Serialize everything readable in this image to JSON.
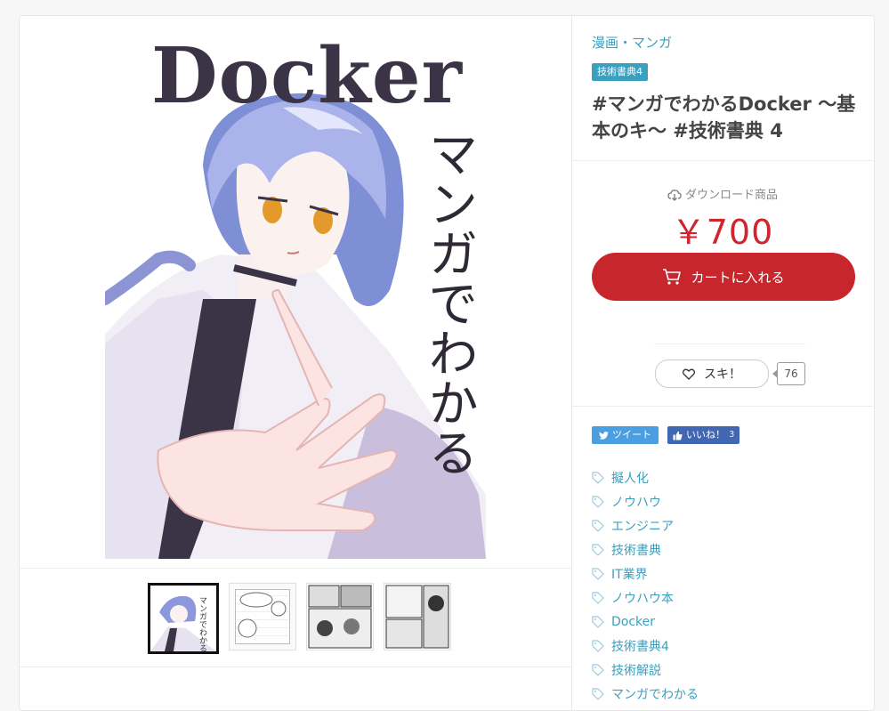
{
  "gallery": {
    "cover": {
      "title": "Docker",
      "subtitle": "マンガでわかる"
    },
    "thumbnails": [
      {
        "name": "thumb-1",
        "active": true
      },
      {
        "name": "thumb-2",
        "active": false
      },
      {
        "name": "thumb-3",
        "active": false
      },
      {
        "name": "thumb-4",
        "active": false
      }
    ]
  },
  "product": {
    "category": "漫画・マンガ",
    "event_badge": "技術書典4",
    "title": "#マンガでわかるDocker 〜基本のキ〜 #技術書典 4",
    "download_label": "ダウンロード商品",
    "price": "￥700",
    "cart_button": "カートに入れる",
    "like_label": "スキ！",
    "like_count": "76"
  },
  "share": {
    "tweet_label": "ツイート",
    "fb_label": "いいね！",
    "fb_count": "3"
  },
  "tags": [
    "擬人化",
    "ノウハウ",
    "エンジニア",
    "技術書典",
    "IT業界",
    "ノウハウ本",
    "Docker",
    "技術書典4",
    "技術解説",
    "マンガでわかる"
  ],
  "colors": {
    "accent": "#3aa0c0",
    "price": "#d0242f",
    "cart_button": "#c7262d",
    "tweet": "#4a9fe0",
    "facebook": "#4267b2"
  }
}
